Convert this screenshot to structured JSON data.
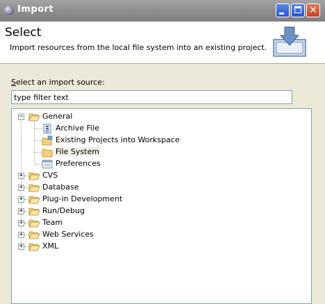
{
  "window": {
    "title": "Import"
  },
  "header": {
    "title": "Select",
    "description": "Import resources from the local file system into an existing project."
  },
  "source": {
    "label_first": "S",
    "label_rest": "elect an import source:",
    "filter_placeholder": "type filter text",
    "filter_value": "type filter text"
  },
  "tree": {
    "general": {
      "label": "General",
      "expanded": true,
      "children": [
        {
          "label": "Archive File",
          "icon": "archive-file-icon"
        },
        {
          "label": "Existing Projects into Workspace",
          "icon": "existing-projects-icon"
        },
        {
          "label": "File System",
          "icon": "folder-icon",
          "selected": true
        },
        {
          "label": "Preferences",
          "icon": "preferences-icon"
        }
      ]
    },
    "categories": [
      {
        "label": "CVS"
      },
      {
        "label": "Database"
      },
      {
        "label": "Plug-in Development"
      },
      {
        "label": "Run/Debug"
      },
      {
        "label": "Team"
      },
      {
        "label": "Web Services"
      },
      {
        "label": "XML"
      }
    ]
  },
  "colors": {
    "titlebar": "#8e8e8e",
    "header_bg": "#ffffff",
    "dialog_bg": "#ece9d8",
    "folder_fill": "#f3d17a",
    "input_border": "#7f9db9"
  }
}
